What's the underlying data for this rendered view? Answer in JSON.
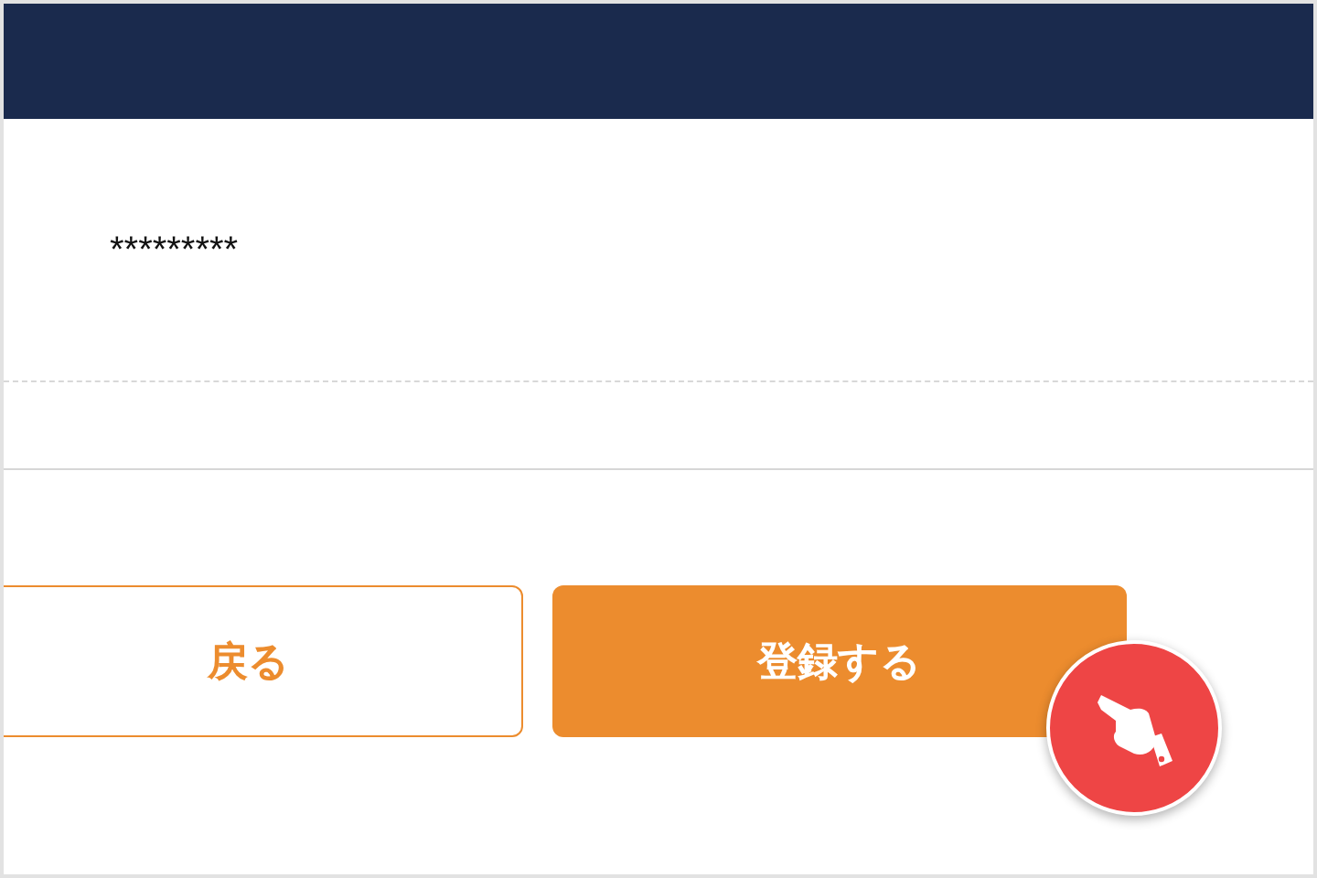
{
  "password_field": {
    "value": "*********"
  },
  "buttons": [
    {
      "label": "戻る",
      "kind": "secondary"
    },
    {
      "label": "登録する",
      "kind": "primary"
    }
  ]
}
